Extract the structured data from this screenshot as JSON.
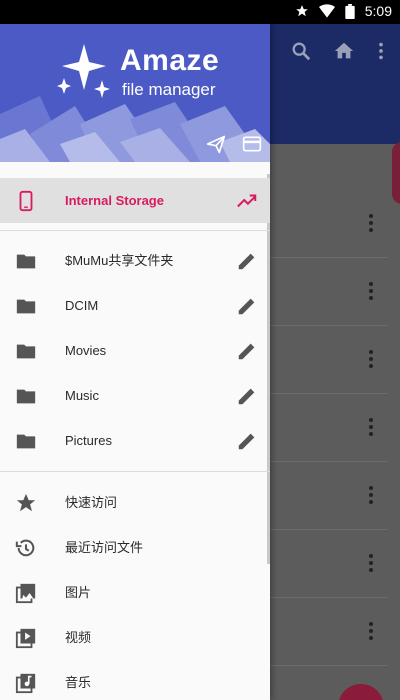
{
  "status_bar": {
    "time": "5:09"
  },
  "header": {
    "app_name": "Amaze",
    "app_subtitle": "file manager"
  },
  "storage": {
    "label": "Internal Storage"
  },
  "bookmarks": [
    {
      "label": "$MuMu共享文件夹"
    },
    {
      "label": "DCIM"
    },
    {
      "label": "Movies"
    },
    {
      "label": "Music"
    },
    {
      "label": "Pictures"
    }
  ],
  "quick_links": [
    {
      "label": "快速访问",
      "icon": "star-icon"
    },
    {
      "label": "最近访问文件",
      "icon": "history-icon"
    },
    {
      "label": "图片",
      "icon": "image-icon"
    },
    {
      "label": "视频",
      "icon": "video-icon"
    },
    {
      "label": "音乐",
      "icon": "music-icon"
    }
  ],
  "colors": {
    "accent": "#d81b60",
    "header": "#4b5ac4",
    "toolbar": "#1c2a66"
  }
}
